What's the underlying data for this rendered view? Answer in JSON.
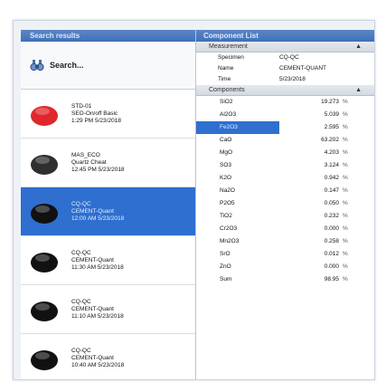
{
  "left_panel": {
    "title": "Search results",
    "search_label": "Search...",
    "results": [
      {
        "line1": "STD-01",
        "line2": "SEO-On/off Basic",
        "line3": "1:29 PM 5/23/2018",
        "color": "#e0272b"
      },
      {
        "line1": "MAS_ECO",
        "line2": "Quartz Cheat",
        "line3": "12:45 PM 5/23/2018",
        "color": "#2f2f31"
      },
      {
        "line1": "CQ-QC",
        "line2": "CEMENT-Quant",
        "line3": "12:00 AM 5/23/2018",
        "color": "#111111",
        "selected": true
      },
      {
        "line1": "CQ-QC",
        "line2": "CEMENT-Quant",
        "line3": "11:30 AM 5/23/2018",
        "color": "#111111"
      },
      {
        "line1": "CQ-QC",
        "line2": "CEMENT-Quant",
        "line3": "11:10 AM 5/23/2018",
        "color": "#111111"
      },
      {
        "line1": "CQ-QC",
        "line2": "CEMENT-Quant",
        "line3": "10:40 AM 5/23/2018",
        "color": "#111111"
      }
    ]
  },
  "right_panel": {
    "title": "Component List",
    "measurement_header": "Measurement",
    "properties": [
      {
        "key": "Specimen",
        "value": "CQ-QC"
      },
      {
        "key": "Name",
        "value": "CEMENT-QUANT"
      },
      {
        "key": "Time",
        "value": "5/23/2018"
      }
    ],
    "components_header": "Components",
    "components": [
      {
        "name": "SiO2",
        "value": "19.273",
        "unit": "%"
      },
      {
        "name": "Al2O3",
        "value": "5.039",
        "unit": "%"
      },
      {
        "name": "Fe2O3",
        "value": "2.595",
        "unit": "%",
        "selected": true
      },
      {
        "name": "CaO",
        "value": "63.202",
        "unit": "%"
      },
      {
        "name": "MgO",
        "value": "4.203",
        "unit": "%"
      },
      {
        "name": "SO3",
        "value": "3.124",
        "unit": "%"
      },
      {
        "name": "K2O",
        "value": "0.942",
        "unit": "%"
      },
      {
        "name": "Na2O",
        "value": "0.147",
        "unit": "%"
      },
      {
        "name": "P2O5",
        "value": "0.050",
        "unit": "%"
      },
      {
        "name": "TiO2",
        "value": "0.232",
        "unit": "%"
      },
      {
        "name": "Cr2O3",
        "value": "0.000",
        "unit": "%"
      },
      {
        "name": "Mn2O3",
        "value": "0.258",
        "unit": "%"
      },
      {
        "name": "SrO",
        "value": "0.012",
        "unit": "%"
      },
      {
        "name": "ZnO",
        "value": "0.000",
        "unit": "%"
      },
      {
        "name": "Sum",
        "value": "98.95",
        "unit": "%"
      }
    ]
  }
}
